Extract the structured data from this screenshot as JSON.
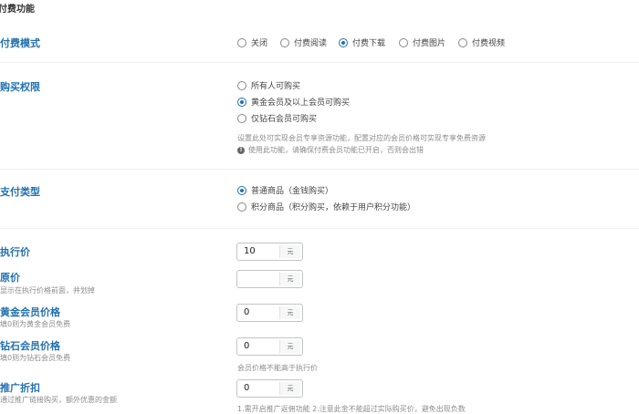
{
  "section_title": "付费功能",
  "pay_mode": {
    "label": "付费模式",
    "options": [
      "关闭",
      "付费阅读",
      "付费下载",
      "付费图片",
      "付费视频"
    ],
    "selected": "付费下载"
  },
  "purchase_permission": {
    "label": "购买权限",
    "options": [
      "所有人可购买",
      "黄金会员及以上会员可购买",
      "仅钻石会员可购买"
    ],
    "selected": "黄金会员及以上会员可购买",
    "help_text": "设置此处可实现会员专享资源功能，配置对应的会员价格可实现专享免费资源",
    "warning_text": "使用此功能，请确保付费会员功能已开启，否则会出错"
  },
  "payment_type": {
    "label": "支付类型",
    "options": [
      "普通商品（金钱购买）",
      "积分商品（积分购买，依赖于用户积分功能）"
    ],
    "selected": "普通商品（金钱购买）"
  },
  "unit": "元",
  "price_fields": [
    {
      "label": "执行价",
      "sublabel": "",
      "value": "10"
    },
    {
      "label": "原价",
      "sublabel": "显示在执行价格前面，并划掉",
      "value": ""
    },
    {
      "label": "黄金会员价格",
      "sublabel": "填0则为黄金会员免费",
      "value": "0"
    },
    {
      "label": "钻石会员价格",
      "sublabel": "填0则为钻石会员免费",
      "value": "0"
    },
    {
      "label": "推广折扣",
      "sublabel": "通过推广链接购买，额外优惠的金额",
      "value": "0"
    }
  ],
  "member_price_note": "会员价格不能高于执行价",
  "promo_note": "1.需开启推广返佣功能 2.注意此金不能超过实际购买价，避免出现负数"
}
